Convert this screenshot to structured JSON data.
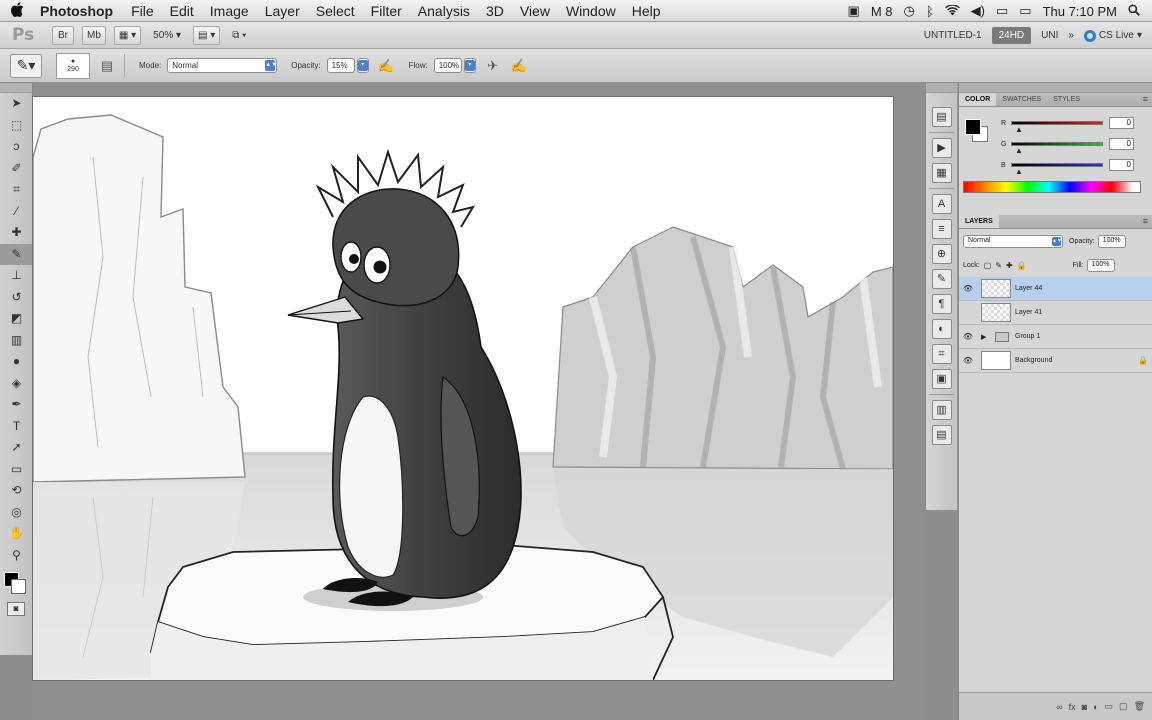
{
  "menubar": {
    "apple": "",
    "app_name": "Photoshop",
    "items": [
      "File",
      "Edit",
      "Image",
      "Layer",
      "Select",
      "Filter",
      "Analysis",
      "3D",
      "View",
      "Window",
      "Help"
    ],
    "status": {
      "m8": "M 8",
      "clock": "Thu 7:10 PM"
    }
  },
  "appbar": {
    "logo": "Ps",
    "zoom": "50%",
    "document": "UNTITLED-1",
    "workspace_active": "24HD",
    "workspace_other": "UNI",
    "overflow": "»",
    "cs_live": "CS Live"
  },
  "options": {
    "brush_size": "290",
    "mode_label": "Mode:",
    "mode_value": "Normal",
    "opacity_label": "Opacity:",
    "opacity_value": "15%",
    "flow_label": "Flow:",
    "flow_value": "100%"
  },
  "color_panel": {
    "tabs": [
      "COLOR",
      "SWATCHES",
      "STYLES"
    ],
    "channels": [
      {
        "label": "R",
        "value": "0"
      },
      {
        "label": "G",
        "value": "0"
      },
      {
        "label": "B",
        "value": "0"
      }
    ],
    "colors": {
      "r_track": "#c03030",
      "g_track": "#2fa02f",
      "b_track": "#2f2fc0"
    }
  },
  "layers_panel": {
    "tab": "LAYERS",
    "blend_mode": "Normal",
    "opacity_label": "Opacity:",
    "opacity_value": "100%",
    "lock_label": "Lock:",
    "fill_label": "Fill:",
    "fill_value": "100%",
    "layers": [
      {
        "name": "Layer 44",
        "visible": true,
        "selected": true
      },
      {
        "name": "Layer 41",
        "visible": false,
        "selected": false
      },
      {
        "name": "Group 1",
        "visible": true,
        "selected": false
      },
      {
        "name": "Background",
        "visible": true,
        "selected": false
      }
    ]
  },
  "tools": [
    "move-tool",
    "marquee-tool",
    "lasso-tool",
    "quick-select-tool",
    "crop-tool",
    "eyedropper-tool",
    "healing-brush-tool",
    "brush-tool",
    "clone-stamp-tool",
    "history-brush-tool",
    "eraser-tool",
    "gradient-tool",
    "dodge-tool",
    "blur-tool",
    "pen-tool",
    "type-tool",
    "path-select-tool",
    "shape-tool",
    "3d-rotate-tool",
    "3d-orbit-tool",
    "hand-tool",
    "zoom-tool"
  ]
}
